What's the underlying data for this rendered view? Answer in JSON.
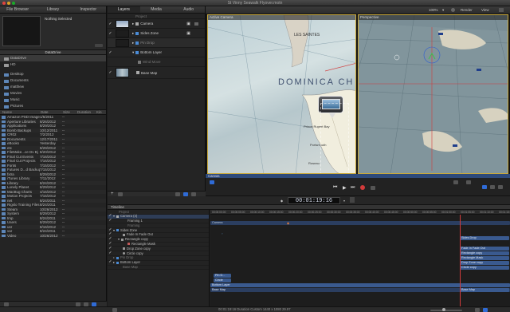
{
  "window": {
    "title": "St Vinny Seawalk Flyover.motn"
  },
  "left_tabs": [
    "File Browser",
    "Library",
    "Inspector"
  ],
  "preview": {
    "status": "Nothing Selected"
  },
  "source": {
    "label": "DataDrive",
    "items": [
      "DataDrive",
      "HD",
      "Desktop",
      "Documents",
      "matthew",
      "Movies",
      "Music",
      "Pictures"
    ]
  },
  "file_columns": [
    "Name",
    "Date",
    "Size",
    "Duration",
    "Kin"
  ],
  "files": [
    [
      "Amazon PSD Images",
      "1/5/2011",
      "--"
    ],
    [
      "Aperture Libraries",
      "8/26/2012",
      "--"
    ],
    [
      "Applications",
      "8/29/2012",
      "--"
    ],
    [
      "Bomb Backups",
      "10/12/2011",
      "--"
    ],
    [
      "CR02",
      "7/2/2012",
      "--"
    ],
    [
      "Documents",
      "12/17/2011",
      "--"
    ],
    [
      "eBooks",
      "Yesterday",
      "--"
    ],
    [
      "etc",
      "8/29/2012",
      "--"
    ],
    [
      "FileMake...ce Dv Bj",
      "8/20/2012",
      "--"
    ],
    [
      "Final Cut Events",
      "7/16/2012",
      "--"
    ],
    [
      "Final Cut Projects",
      "7/16/2012",
      "--"
    ],
    [
      "Fonts",
      "7/15/2012",
      "--"
    ],
    [
      "Futures D...d Backup",
      "7/15/2012",
      "--"
    ],
    [
      "fxtra",
      "8/29/2012",
      "--"
    ],
    [
      "iTunes Library",
      "7/11/2012",
      "--"
    ],
    [
      "Library",
      "8/24/2012",
      "--"
    ],
    [
      "Lonely Planet",
      "8/29/2012",
      "--"
    ],
    [
      "MacBug Charts",
      "4/16/2012",
      "--"
    ],
    [
      "Motion Projects",
      "7/15/2012",
      "--"
    ],
    [
      "net",
      "8/24/2011",
      "--"
    ],
    [
      "Rigslo Training Files",
      "8/24/2011",
      "--"
    ],
    [
      "Steam",
      "10/26/2012",
      "--"
    ],
    [
      "System",
      "8/29/2012",
      "--"
    ],
    [
      "tmp",
      "8/24/2011",
      "--"
    ],
    [
      "Users",
      "8/29/2012",
      "--"
    ],
    [
      "usr",
      "8/16/2012",
      "--"
    ],
    [
      "var",
      "8/24/2011",
      "--"
    ],
    [
      "Video",
      "10/26/2012",
      "--"
    ]
  ],
  "mid_tabs": [
    "Layers",
    "Media",
    "Audio"
  ],
  "layers": [
    {
      "name": "Project",
      "check": ""
    },
    {
      "name": "Camera",
      "check": "✓"
    },
    {
      "name": "Sides Zone",
      "check": "✓"
    },
    {
      "name": "Pin Drop",
      "check": ""
    },
    {
      "name": "Bottom Layer",
      "check": "✓"
    },
    {
      "name": "Wind Move",
      "check": ""
    },
    {
      "name": "Base Map",
      "check": "✓"
    }
  ],
  "viewer": {
    "zoom": "100%",
    "render": "Render",
    "view": "View",
    "left_camera": "Active Camera",
    "right_camera": "Perspective"
  },
  "map_labels": {
    "saintes": "LES SAINTES",
    "dominica": "DOMINICA CH",
    "prince": "Prince Rupert Bay",
    "roseau": "Roseau",
    "portsmouth": "Portsmouth",
    "callout": "Portsmouth"
  },
  "canvas_label": "Canvas",
  "timecode": "00:01:19:16",
  "timeline": {
    "tab": "Timeline",
    "rows": [
      "Project",
      "Camera (4)",
      "Framing 1",
      "Framing",
      "Sides Zone",
      "Fade In Fade Out",
      "Rectangle copy",
      "Rectangle Mask",
      "Drop Zone copy",
      "Circle copy",
      "Pin Drop",
      "Bottom Layer",
      "Base Map"
    ],
    "ruler": [
      "00:00:00:00",
      "00:00:05:00",
      "00:00:10:00",
      "00:00:15:00",
      "00:00:20:00",
      "00:00:25:00",
      "00:00:30:00",
      "00:00:35:00",
      "00:00:40:00",
      "00:00:45:00",
      "00:00:50:00",
      "00:00:55:00",
      "00:01:00:00",
      "00:01:05:00",
      "00:01:10:00",
      "00:01:15:00"
    ],
    "clips": {
      "camera": "Camera",
      "sides": "Sides Drop",
      "fade": "Fade In Fade Out",
      "rect": "Rectangle copy",
      "mask": "Rectangle Mask",
      "drop": "Drop Zone copy",
      "circle": "Circle copy",
      "pin": "Pin D...",
      "pin2": "Circle",
      "bottom": "Bottom Layer",
      "base": "Base Map",
      "base2": "Base Map"
    }
  },
  "status": "00:01:19:16 Duration Custom 1440 x 1080 29.97",
  "colors": {
    "accent": "#2f6bd6",
    "play_red": "#d23b3b"
  }
}
